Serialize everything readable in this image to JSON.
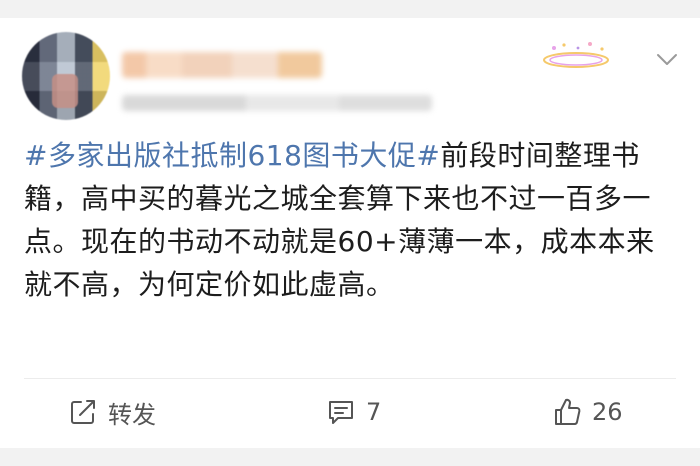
{
  "post": {
    "topic": "#多家出版社抵制618图书大促#",
    "body": "前段时间整理书籍，高中买的暮光之城全套算下来也不过一百多一点。现在的书动不动就是60+薄薄一本，成本本来就不高，为何定价如此虚高。"
  },
  "actions": {
    "repost_label": "转发",
    "comment_count": "7",
    "like_count": "26"
  },
  "icons": {
    "repost": "repost-icon",
    "comment": "comment-icon",
    "like": "thumbs-up-icon",
    "menu": "chevron-down-icon"
  },
  "colors": {
    "topic": "#4e76ad",
    "text": "#1d1d1d",
    "icon": "#555555"
  }
}
